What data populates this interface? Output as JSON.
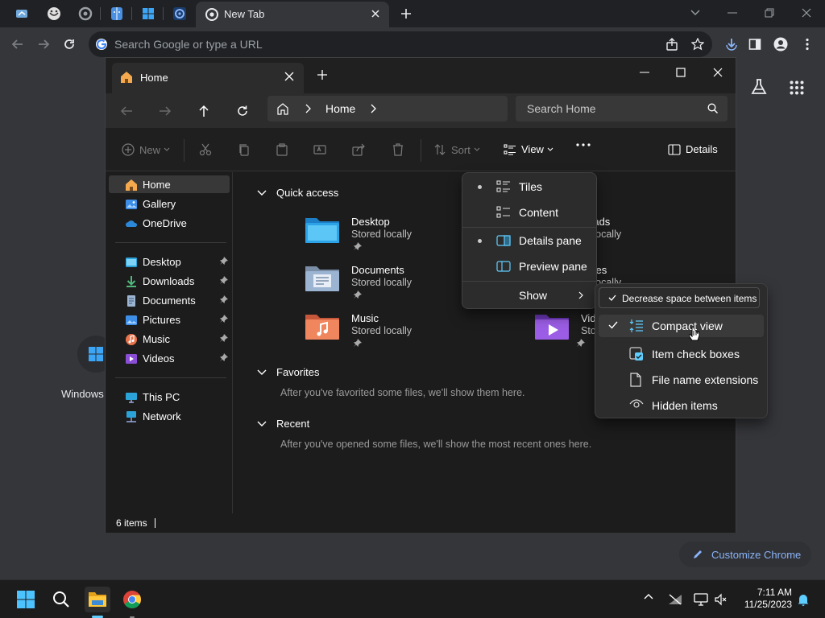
{
  "chrome": {
    "tab_title": "New Tab",
    "pinned_tabs": [
      "app-icon",
      "trollface-icon",
      "chrome-settings-icon",
      "finder-icon",
      "windows-logo-icon",
      "gear-app-icon"
    ],
    "omnibox_placeholder": "Search Google or type a URL"
  },
  "ntp": {
    "shortcut_label": "Windows",
    "customize_label": "Customize Chrome"
  },
  "explorer": {
    "tab_title": "Home",
    "breadcrumb": [
      "Home"
    ],
    "search_placeholder": "Search Home",
    "commands": {
      "new": "New",
      "sort": "Sort",
      "view": "View",
      "details": "Details"
    },
    "sidebar": {
      "top": [
        {
          "label": "Home",
          "icon": "home-icon",
          "selected": true
        },
        {
          "label": "Gallery",
          "icon": "gallery-icon"
        },
        {
          "label": "OneDrive",
          "icon": "onedrive-icon"
        }
      ],
      "pinned": [
        {
          "label": "Desktop",
          "icon": "desktop-folder-icon"
        },
        {
          "label": "Downloads",
          "icon": "downloads-icon"
        },
        {
          "label": "Documents",
          "icon": "documents-icon"
        },
        {
          "label": "Pictures",
          "icon": "pictures-icon"
        },
        {
          "label": "Music",
          "icon": "music-icon"
        },
        {
          "label": "Videos",
          "icon": "videos-icon"
        }
      ],
      "bottom": [
        {
          "label": "This PC",
          "icon": "this-pc-icon"
        },
        {
          "label": "Network",
          "icon": "network-icon"
        }
      ]
    },
    "quick_access": {
      "title": "Quick access",
      "items": [
        {
          "name": "Desktop",
          "sub": "Stored locally"
        },
        {
          "name": "Documents",
          "sub": "Stored locally"
        },
        {
          "name": "Music",
          "sub": "Stored locally"
        },
        {
          "name": "nloads",
          "sub": "ed locally"
        },
        {
          "name": "ures",
          "sub": "ed locally"
        },
        {
          "name": "Vid",
          "sub": "Sto"
        }
      ]
    },
    "favorites": {
      "title": "Favorites",
      "empty": "After you've favorited some files, we'll show them here."
    },
    "recent": {
      "title": "Recent",
      "empty": "After you've opened some files, we'll show the most recent ones here."
    },
    "status": "6 items"
  },
  "view_menu": {
    "items": [
      {
        "label": "Tiles",
        "selected": true
      },
      {
        "label": "Content",
        "selected": false
      },
      {
        "label": "Details pane",
        "selected": true
      },
      {
        "label": "Preview pane",
        "selected": false
      },
      {
        "label": "Show",
        "submenu": true
      }
    ]
  },
  "show_menu": {
    "tooltip": "Decrease space between items",
    "items": [
      {
        "label": "Compact view",
        "checked": true
      },
      {
        "label": "Item check boxes",
        "checked": false
      },
      {
        "label": "File name extensions",
        "checked": false
      },
      {
        "label": "Hidden items",
        "checked": false
      }
    ]
  },
  "taskbar": {
    "time": "7:11 AM",
    "date": "11/25/2023"
  },
  "colors": {
    "accent": "#60cdff",
    "folder_blue": "#3d8ee6",
    "link_blue": "#8ab4f8"
  }
}
